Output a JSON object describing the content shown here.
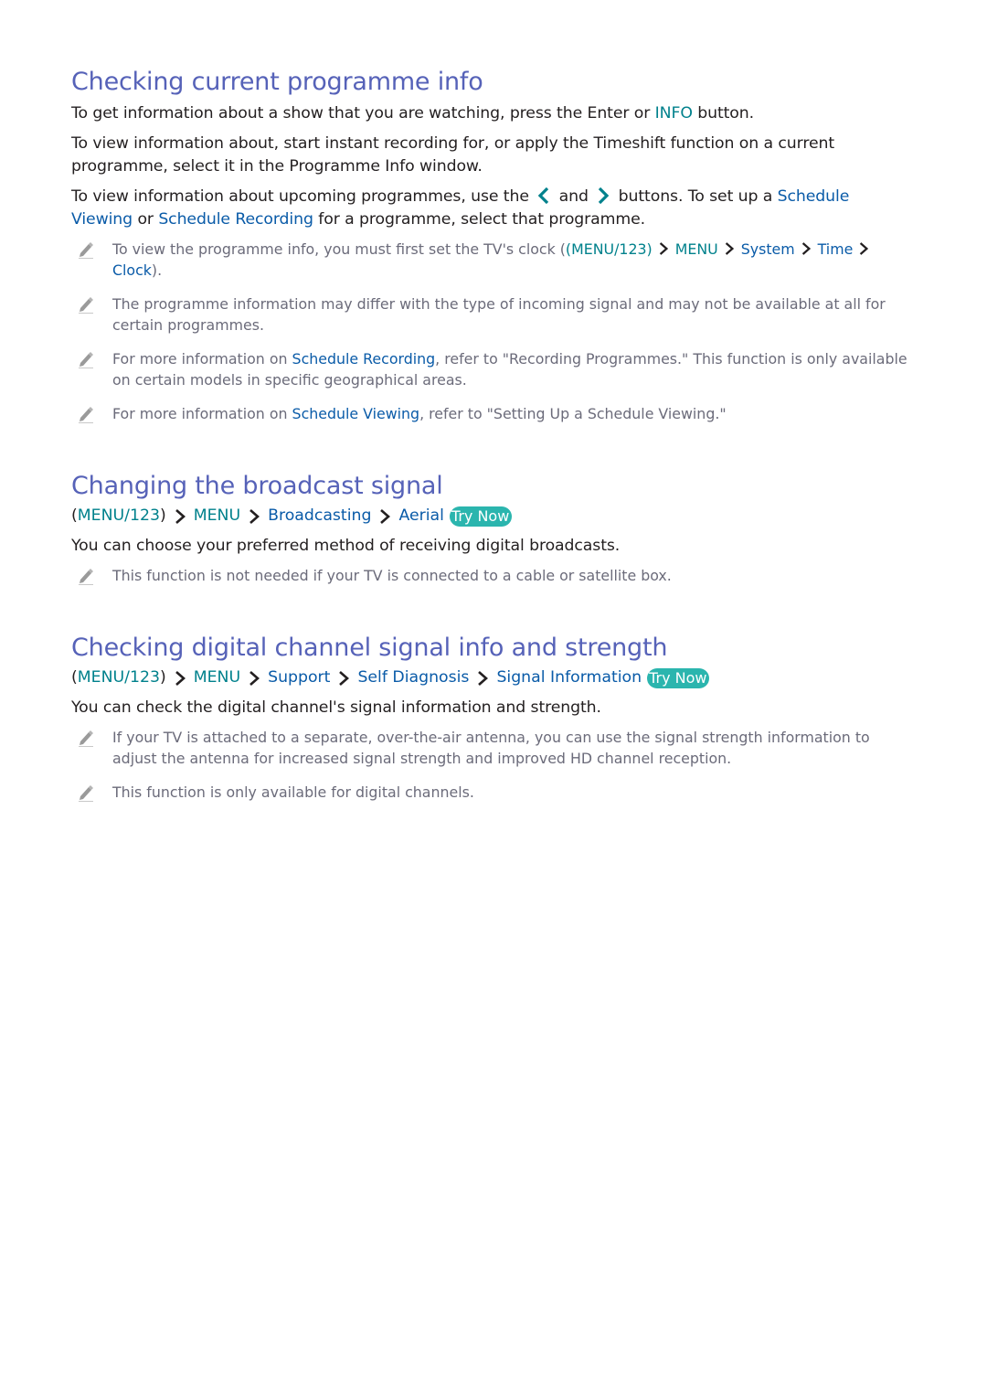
{
  "sections": [
    {
      "title": "Checking current programme info",
      "paragraphs": {
        "p1_a": "To get information about a show that you are watching, press the Enter or ",
        "p1_info": "INFO",
        "p1_b": " button.",
        "p2": "To view information about, start instant recording for, or apply the Timeshift function on a current programme, select it in the Programme Info window.",
        "p3_a": "To view information about upcoming programmes, use the ",
        "p3_and": " and ",
        "p3_b": " buttons. To set up a ",
        "p3_link1": "Schedule Viewing",
        "p3_or": " or ",
        "p3_link2": "Schedule Recording",
        "p3_c": " for a programme, select that programme."
      },
      "notes": {
        "n1_a": "To view the programme info, you must first set the TV's clock (",
        "n1_menu123": "(MENU/123)",
        "n1_menu": "MENU",
        "n1_system": "System",
        "n1_time": "Time",
        "n1_clock": "Clock",
        "n1_end": ").",
        "n2": "The programme information may differ with the type of incoming signal and may not be available at all for certain programmes.",
        "n3_a": "For more information on ",
        "n3_link": "Schedule Recording",
        "n3_b": ", refer to \"Recording Programmes.\" This function is only available on certain models in specific geographical areas.",
        "n4_a": "For more information on ",
        "n4_link": "Schedule Viewing",
        "n4_b": ", refer to \"Setting Up a Schedule Viewing.\""
      }
    },
    {
      "title": "Changing the broadcast signal",
      "path": {
        "paren_open": "(",
        "menu123": "MENU/123",
        "paren_close": ")",
        "menu": "MENU",
        "item1": "Broadcasting",
        "item2": "Aerial",
        "try_now": "Try Now"
      },
      "body": "You can choose your preferred method of receiving digital broadcasts.",
      "notes": [
        "This function is not needed if your TV is connected to a cable or satellite box."
      ]
    },
    {
      "title": "Checking digital channel signal info and strength",
      "path": {
        "paren_open": "(",
        "menu123": "MENU/123",
        "paren_close": ")",
        "menu": "MENU",
        "item1": "Support",
        "item2": "Self Diagnosis",
        "item3": "Signal Information",
        "try_now": "Try Now"
      },
      "body": "You can check the digital channel's signal information and strength.",
      "notes": [
        "If your TV is attached to a separate, over-the-air antenna, you can use the signal strength information to adjust the antenna for increased signal strength and improved HD channel reception.",
        "This function is only available for digital channels."
      ]
    }
  ],
  "colors": {
    "heading": "#5662b8",
    "link": "#0a5ba8",
    "teal": "#00818c",
    "try_now_bg": "#2bb5ae",
    "note_text": "#6b6b7a"
  }
}
